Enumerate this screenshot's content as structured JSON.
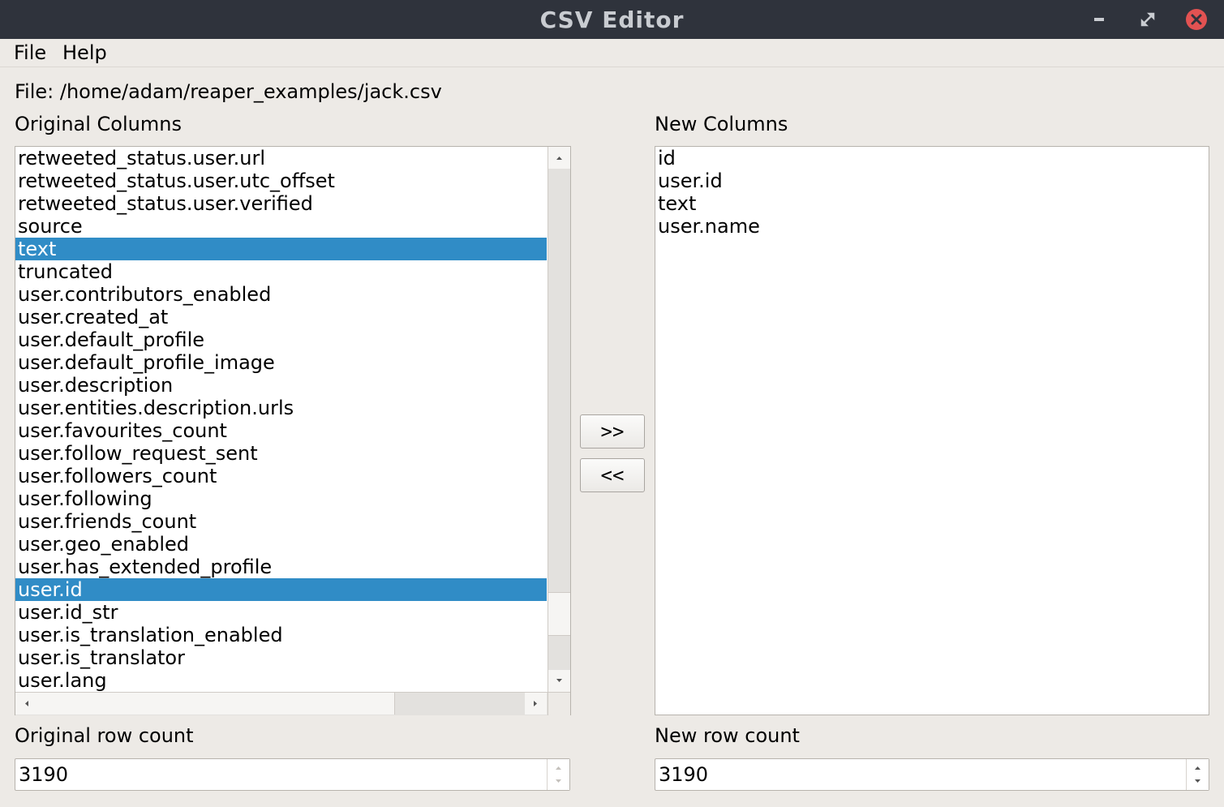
{
  "window": {
    "title": "CSV Editor"
  },
  "menu": {
    "items": [
      "File",
      "Help"
    ]
  },
  "file_label": "File: /home/adam/reaper_examples/jack.csv",
  "original": {
    "heading": "Original Columns",
    "items": [
      {
        "label": "retweeted_status.user.url",
        "selected": false
      },
      {
        "label": "retweeted_status.user.utc_offset",
        "selected": false
      },
      {
        "label": "retweeted_status.user.verified",
        "selected": false
      },
      {
        "label": "source",
        "selected": false
      },
      {
        "label": "text",
        "selected": true
      },
      {
        "label": "truncated",
        "selected": false
      },
      {
        "label": "user.contributors_enabled",
        "selected": false
      },
      {
        "label": "user.created_at",
        "selected": false
      },
      {
        "label": "user.default_profile",
        "selected": false
      },
      {
        "label": "user.default_profile_image",
        "selected": false
      },
      {
        "label": "user.description",
        "selected": false
      },
      {
        "label": "user.entities.description.urls",
        "selected": false
      },
      {
        "label": "user.favourites_count",
        "selected": false
      },
      {
        "label": "user.follow_request_sent",
        "selected": false
      },
      {
        "label": "user.followers_count",
        "selected": false
      },
      {
        "label": "user.following",
        "selected": false
      },
      {
        "label": "user.friends_count",
        "selected": false
      },
      {
        "label": "user.geo_enabled",
        "selected": false
      },
      {
        "label": "user.has_extended_profile",
        "selected": false
      },
      {
        "label": "user.id",
        "selected": true
      },
      {
        "label": "user.id_str",
        "selected": false
      },
      {
        "label": "user.is_translation_enabled",
        "selected": false
      },
      {
        "label": "user.is_translator",
        "selected": false
      },
      {
        "label": "user.lang",
        "selected": false
      }
    ],
    "row_count_label": "Original row count",
    "row_count": "3190"
  },
  "new": {
    "heading": "New Columns",
    "items": [
      "id",
      "user.id",
      "text",
      "user.name"
    ],
    "row_count_label": "New row count",
    "row_count": "3190"
  },
  "buttons": {
    "add": ">>",
    "remove": "<<"
  },
  "colors": {
    "selection": "#308cc6",
    "titlebar": "#2f333c",
    "close": "#e25252",
    "window_bg": "#edeae6"
  },
  "icons": {
    "minimize": "minimize-icon",
    "maximize": "maximize-icon",
    "close": "close-icon"
  }
}
